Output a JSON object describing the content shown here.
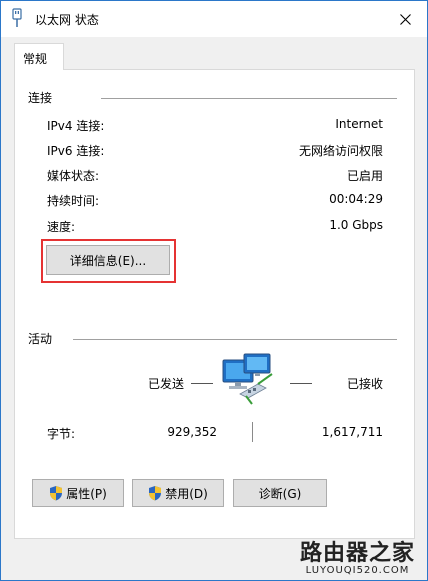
{
  "window": {
    "title": "以太网 状态"
  },
  "tabs": [
    {
      "label": "常规"
    }
  ],
  "connection": {
    "heading": "连接",
    "rows": [
      {
        "label": "IPv4 连接:",
        "value": "Internet"
      },
      {
        "label": "IPv6 连接:",
        "value": "无网络访问权限"
      },
      {
        "label": "媒体状态:",
        "value": "已启用"
      },
      {
        "label": "持续时间:",
        "value": "00:04:29"
      },
      {
        "label": "速度:",
        "value": "1.0 Gbps"
      }
    ],
    "details_button": "详细信息(E)..."
  },
  "activity": {
    "heading": "活动",
    "sent_label": "已发送",
    "received_label": "已接收",
    "bytes_label": "字节:",
    "bytes_sent": "929,352",
    "bytes_received": "1,617,711"
  },
  "buttons": {
    "properties": "属性(P)",
    "disable": "禁用(D)",
    "diagnose": "诊断(G)"
  },
  "watermark": {
    "main": "路由器之家",
    "sub": "LUYOUQI520.COM"
  },
  "colors": {
    "highlight": "#e53333",
    "accent": "#2b77c9"
  },
  "icons": {
    "title": "ethernet-plug-icon",
    "close": "close-icon",
    "network": "network-computers-icon",
    "shield": "uac-shield-icon"
  }
}
